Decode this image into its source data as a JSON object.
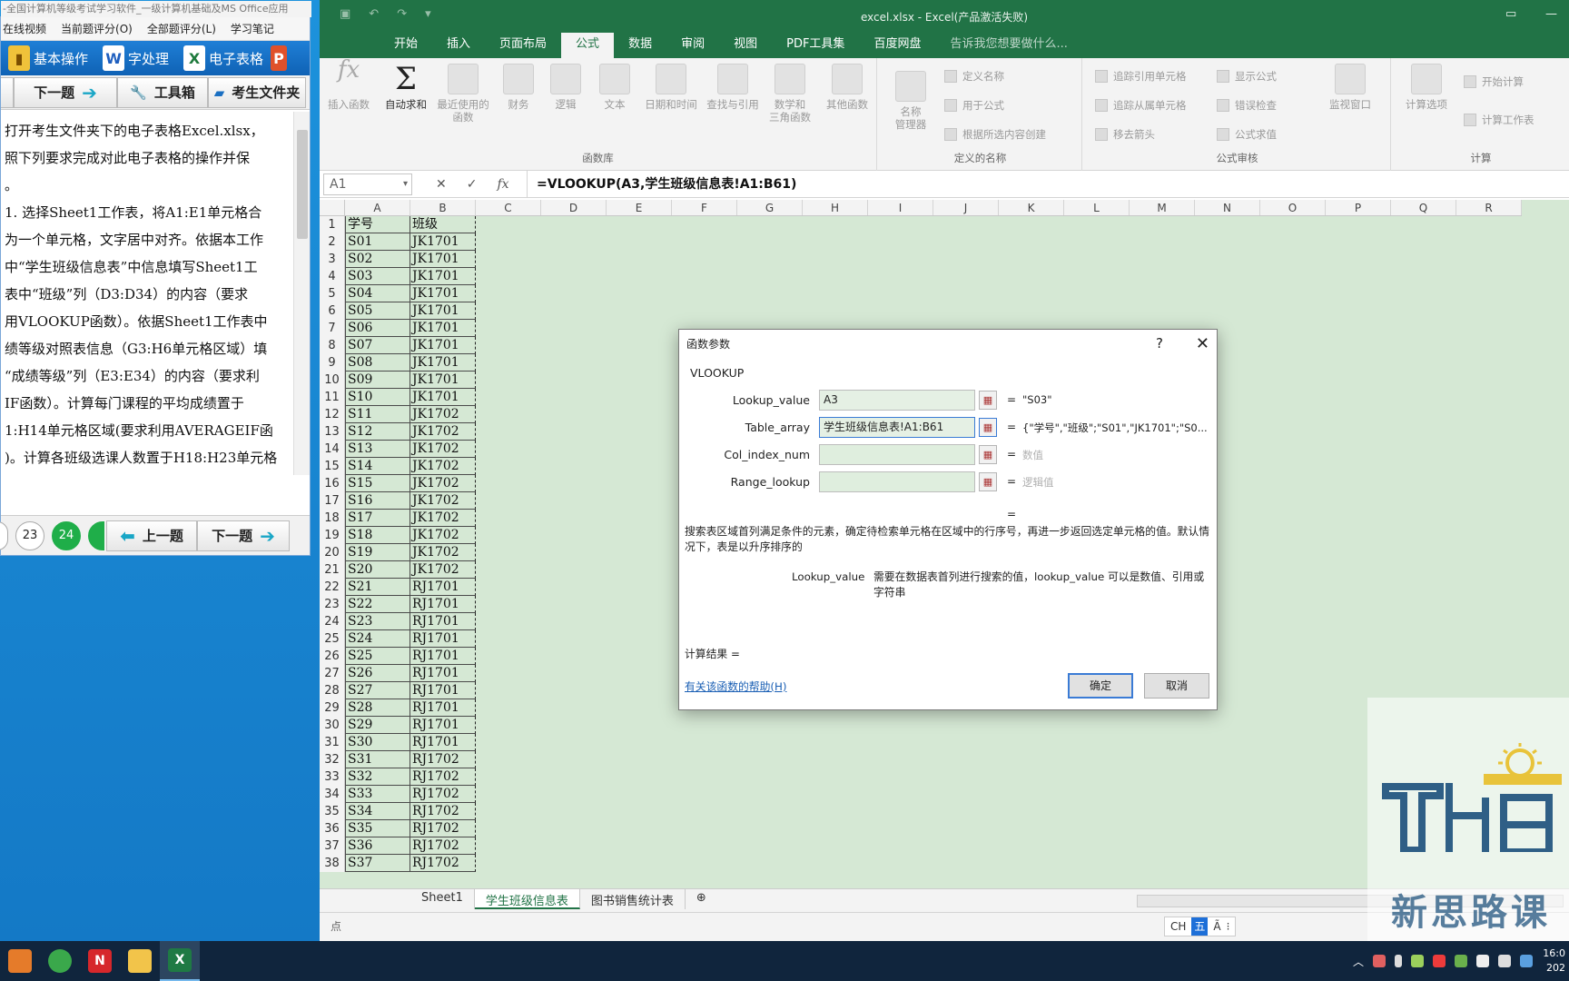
{
  "exam": {
    "title": "-全国计算机等级考试学习软件_一级计算机基础及MS Office应用",
    "menu": [
      "在线视频",
      "当前题评分(O)",
      "全部题评分(L)",
      "学习笔记"
    ],
    "tabs": [
      "基本操作",
      "字处理",
      "电子表格",
      "P"
    ],
    "nav": {
      "next": "下一题",
      "toolbox": "工具箱",
      "folder": "考生文件夹"
    },
    "body": [
      "   打开考生文件夹下的电子表格Excel.xlsx，",
      "照下列要求完成对此电子表格的操作并保",
      "。",
      "   1. 选择Sheet1工作表，将A1:E1单元格合",
      "为一个单元格，文字居中对齐。依据本工作",
      "中“学生班级信息表”中信息填写Sheet1工",
      "表中“班级”列（D3:D34）的内容（要求",
      "用VLOOKUP函数）。依据Sheet1工作表中",
      "绩等级对照表信息（G3:H6单元格区域）填",
      "“成绩等级”列（E3:E34）的内容（要求利",
      "IF函数）。计算每门课程的平均成绩置于",
      "1:H14单元格区域(要求利用AVERAGEIF函",
      ")。计算各班级选课人数置于H18:H23单元格"
    ],
    "bottom": {
      "q23": "23",
      "q24": "24",
      "prev": "上一题",
      "next": "下一题"
    }
  },
  "excel": {
    "title": "excel.xlsx - Excel(产品激活失败)",
    "tabs": [
      "开始",
      "插入",
      "页面布局",
      "公式",
      "数据",
      "审阅",
      "视图",
      "PDF工具集",
      "百度网盘",
      "告诉我您想要做什么..."
    ],
    "active_tab": "公式",
    "ribbon": {
      "insert_fn": "插入函数",
      "autosum": "自动求和",
      "recent": "最近使用的\n函数",
      "finance": "财务",
      "logic": "逻辑",
      "text": "文本",
      "datetime": "日期和时间",
      "lookup": "查找与引用",
      "math": "数学和\n三角函数",
      "other": "其他函数",
      "library_label": "函数库",
      "name_mgr": "名称\n管理器",
      "define_name": "定义名称",
      "use_in_formula": "用于公式",
      "create_from_sel": "根据所选内容创建",
      "defined_names_label": "定义的名称",
      "trace_prec": "追踪引用单元格",
      "trace_dep": "追踪从属单元格",
      "remove_arrows": "移去箭头",
      "show_formulas": "显示公式",
      "error_check": "错误检查",
      "eval_formula": "公式求值",
      "watch": "监视窗口",
      "audit_label": "公式审核",
      "calc_options": "计算选项",
      "calc_now": "开始计算",
      "calc_sheet": "计算工作表",
      "calc_label": "计算"
    },
    "namebox": "A1",
    "formula": "=VLOOKUP(A3,学生班级信息表!A1:B61)",
    "columns": [
      "A",
      "B",
      "C",
      "D",
      "E",
      "F",
      "G",
      "H",
      "I",
      "J",
      "K",
      "L",
      "M",
      "N",
      "O",
      "P",
      "Q",
      "R"
    ],
    "rows": [
      [
        "1",
        "学号",
        "班级"
      ],
      [
        "2",
        "S01",
        "JK1701"
      ],
      [
        "3",
        "S02",
        "JK1701"
      ],
      [
        "4",
        "S03",
        "JK1701"
      ],
      [
        "5",
        "S04",
        "JK1701"
      ],
      [
        "6",
        "S05",
        "JK1701"
      ],
      [
        "7",
        "S06",
        "JK1701"
      ],
      [
        "8",
        "S07",
        "JK1701"
      ],
      [
        "9",
        "S08",
        "JK1701"
      ],
      [
        "10",
        "S09",
        "JK1701"
      ],
      [
        "11",
        "S10",
        "JK1701"
      ],
      [
        "12",
        "S11",
        "JK1702"
      ],
      [
        "13",
        "S12",
        "JK1702"
      ],
      [
        "14",
        "S13",
        "JK1702"
      ],
      [
        "15",
        "S14",
        "JK1702"
      ],
      [
        "16",
        "S15",
        "JK1702"
      ],
      [
        "17",
        "S16",
        "JK1702"
      ],
      [
        "18",
        "S17",
        "JK1702"
      ],
      [
        "19",
        "S18",
        "JK1702"
      ],
      [
        "20",
        "S19",
        "JK1702"
      ],
      [
        "21",
        "S20",
        "JK1702"
      ],
      [
        "22",
        "S21",
        "RJ1701"
      ],
      [
        "23",
        "S22",
        "RJ1701"
      ],
      [
        "24",
        "S23",
        "RJ1701"
      ],
      [
        "25",
        "S24",
        "RJ1701"
      ],
      [
        "26",
        "S25",
        "RJ1701"
      ],
      [
        "27",
        "S26",
        "RJ1701"
      ],
      [
        "28",
        "S27",
        "RJ1701"
      ],
      [
        "29",
        "S28",
        "RJ1701"
      ],
      [
        "30",
        "S29",
        "RJ1701"
      ],
      [
        "31",
        "S30",
        "RJ1701"
      ],
      [
        "32",
        "S31",
        "RJ1702"
      ],
      [
        "33",
        "S32",
        "RJ1702"
      ],
      [
        "34",
        "S33",
        "RJ1702"
      ],
      [
        "35",
        "S34",
        "RJ1702"
      ],
      [
        "36",
        "S35",
        "RJ1702"
      ],
      [
        "37",
        "S36",
        "RJ1702"
      ],
      [
        "38",
        "S37",
        "RJ1702"
      ]
    ],
    "sheet_tabs": [
      "Sheet1",
      "学生班级信息表",
      "图书销售统计表"
    ],
    "active_sheet": "学生班级信息表",
    "status": "点",
    "ime": {
      "lang": "CH",
      "mode": "五"
    }
  },
  "dialog": {
    "title": "函数参数",
    "help_q": "?",
    "close": "✕",
    "function": "VLOOKUP",
    "args": [
      {
        "label": "Lookup_value",
        "value": "A3",
        "result": "\"S03\"",
        "grey": false
      },
      {
        "label": "Table_array",
        "value": "学生班级信息表!A1:B61",
        "result": "{\"学号\",\"班级\";\"S01\",\"JK1701\";\"S0...",
        "grey": false
      },
      {
        "label": "Col_index_num",
        "value": "",
        "result": "数值",
        "grey": true
      },
      {
        "label": "Range_lookup",
        "value": "",
        "result": "逻辑值",
        "grey": true
      }
    ],
    "equals": "=",
    "description": "搜索表区域首列满足条件的元素，确定待检索单元格在区域中的行序号，再进一步返回选定单元格的值。默认情况下，表是以升序排序的",
    "arg_desc_key": "Lookup_value",
    "arg_desc": "需要在数据表首列进行搜索的值，lookup_value 可以是数值、引用或字符串",
    "calc_result": "计算结果 =",
    "help_link": "有关该函数的帮助(H)",
    "ok": "确定",
    "cancel": "取消"
  },
  "watermark": {
    "text": "新思路课"
  },
  "taskbar": {
    "clock_time": "16:0",
    "clock_date": "202"
  }
}
